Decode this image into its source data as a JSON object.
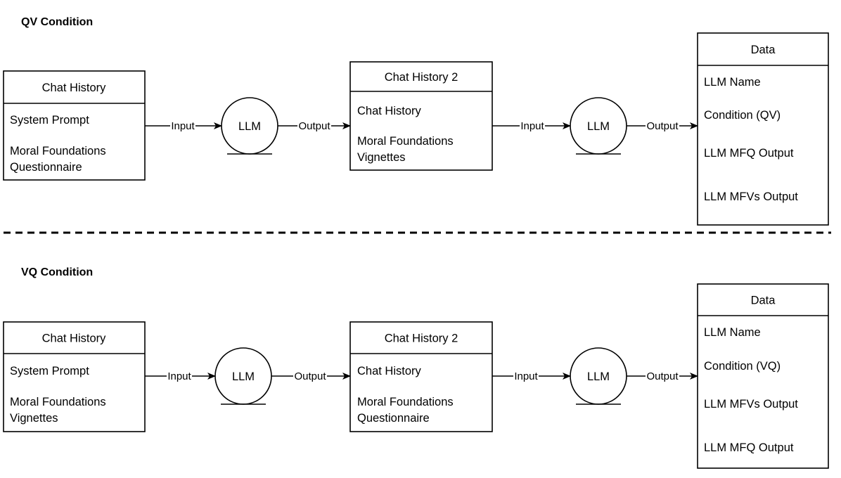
{
  "sections": [
    {
      "title": "QV Condition",
      "input_box": {
        "header": "Chat History",
        "items": [
          "System Prompt",
          "Moral Foundations",
          "Questionnaire"
        ]
      },
      "llm1": "LLM",
      "middle_box": {
        "header": "Chat History 2",
        "items": [
          "Chat History",
          "Moral Foundations",
          "Vignettes"
        ]
      },
      "llm2": "LLM",
      "data_box": {
        "header": "Data",
        "items": [
          "LLM Name",
          "Condition (QV)",
          "LLM MFQ Output",
          "LLM MFVs Output"
        ]
      },
      "edge_labels": [
        "Input",
        "Output",
        "Input",
        "Output"
      ]
    },
    {
      "title": "VQ Condition",
      "input_box": {
        "header": "Chat History",
        "items": [
          "System Prompt",
          "Moral Foundations",
          "Vignettes"
        ]
      },
      "llm1": "LLM",
      "middle_box": {
        "header": "Chat History 2",
        "items": [
          "Chat History",
          "Moral Foundations",
          "Questionnaire"
        ]
      },
      "llm2": "LLM",
      "data_box": {
        "header": "Data",
        "items": [
          "LLM Name",
          "Condition (VQ)",
          "LLM MFVs Output",
          "LLM MFQ Output"
        ]
      },
      "edge_labels": [
        "Input",
        "Output",
        "Input",
        "Output"
      ]
    }
  ]
}
